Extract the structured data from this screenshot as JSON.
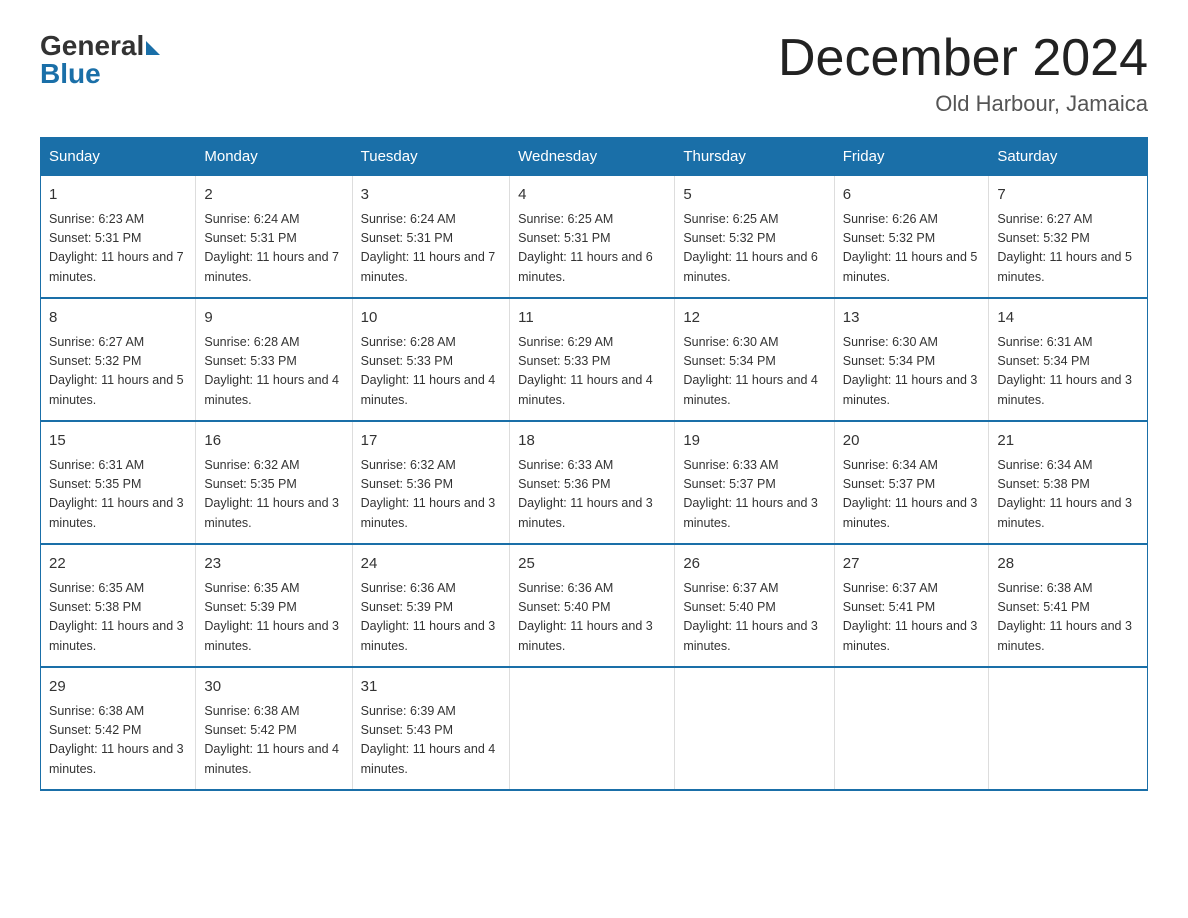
{
  "header": {
    "logo_general": "General",
    "logo_blue": "Blue",
    "title": "December 2024",
    "subtitle": "Old Harbour, Jamaica"
  },
  "days_of_week": [
    "Sunday",
    "Monday",
    "Tuesday",
    "Wednesday",
    "Thursday",
    "Friday",
    "Saturday"
  ],
  "weeks": [
    [
      {
        "day": "1",
        "sunrise": "6:23 AM",
        "sunset": "5:31 PM",
        "daylight": "11 hours and 7 minutes."
      },
      {
        "day": "2",
        "sunrise": "6:24 AM",
        "sunset": "5:31 PM",
        "daylight": "11 hours and 7 minutes."
      },
      {
        "day": "3",
        "sunrise": "6:24 AM",
        "sunset": "5:31 PM",
        "daylight": "11 hours and 7 minutes."
      },
      {
        "day": "4",
        "sunrise": "6:25 AM",
        "sunset": "5:31 PM",
        "daylight": "11 hours and 6 minutes."
      },
      {
        "day": "5",
        "sunrise": "6:25 AM",
        "sunset": "5:32 PM",
        "daylight": "11 hours and 6 minutes."
      },
      {
        "day": "6",
        "sunrise": "6:26 AM",
        "sunset": "5:32 PM",
        "daylight": "11 hours and 5 minutes."
      },
      {
        "day": "7",
        "sunrise": "6:27 AM",
        "sunset": "5:32 PM",
        "daylight": "11 hours and 5 minutes."
      }
    ],
    [
      {
        "day": "8",
        "sunrise": "6:27 AM",
        "sunset": "5:32 PM",
        "daylight": "11 hours and 5 minutes."
      },
      {
        "day": "9",
        "sunrise": "6:28 AM",
        "sunset": "5:33 PM",
        "daylight": "11 hours and 4 minutes."
      },
      {
        "day": "10",
        "sunrise": "6:28 AM",
        "sunset": "5:33 PM",
        "daylight": "11 hours and 4 minutes."
      },
      {
        "day": "11",
        "sunrise": "6:29 AM",
        "sunset": "5:33 PM",
        "daylight": "11 hours and 4 minutes."
      },
      {
        "day": "12",
        "sunrise": "6:30 AM",
        "sunset": "5:34 PM",
        "daylight": "11 hours and 4 minutes."
      },
      {
        "day": "13",
        "sunrise": "6:30 AM",
        "sunset": "5:34 PM",
        "daylight": "11 hours and 3 minutes."
      },
      {
        "day": "14",
        "sunrise": "6:31 AM",
        "sunset": "5:34 PM",
        "daylight": "11 hours and 3 minutes."
      }
    ],
    [
      {
        "day": "15",
        "sunrise": "6:31 AM",
        "sunset": "5:35 PM",
        "daylight": "11 hours and 3 minutes."
      },
      {
        "day": "16",
        "sunrise": "6:32 AM",
        "sunset": "5:35 PM",
        "daylight": "11 hours and 3 minutes."
      },
      {
        "day": "17",
        "sunrise": "6:32 AM",
        "sunset": "5:36 PM",
        "daylight": "11 hours and 3 minutes."
      },
      {
        "day": "18",
        "sunrise": "6:33 AM",
        "sunset": "5:36 PM",
        "daylight": "11 hours and 3 minutes."
      },
      {
        "day": "19",
        "sunrise": "6:33 AM",
        "sunset": "5:37 PM",
        "daylight": "11 hours and 3 minutes."
      },
      {
        "day": "20",
        "sunrise": "6:34 AM",
        "sunset": "5:37 PM",
        "daylight": "11 hours and 3 minutes."
      },
      {
        "day": "21",
        "sunrise": "6:34 AM",
        "sunset": "5:38 PM",
        "daylight": "11 hours and 3 minutes."
      }
    ],
    [
      {
        "day": "22",
        "sunrise": "6:35 AM",
        "sunset": "5:38 PM",
        "daylight": "11 hours and 3 minutes."
      },
      {
        "day": "23",
        "sunrise": "6:35 AM",
        "sunset": "5:39 PM",
        "daylight": "11 hours and 3 minutes."
      },
      {
        "day": "24",
        "sunrise": "6:36 AM",
        "sunset": "5:39 PM",
        "daylight": "11 hours and 3 minutes."
      },
      {
        "day": "25",
        "sunrise": "6:36 AM",
        "sunset": "5:40 PM",
        "daylight": "11 hours and 3 minutes."
      },
      {
        "day": "26",
        "sunrise": "6:37 AM",
        "sunset": "5:40 PM",
        "daylight": "11 hours and 3 minutes."
      },
      {
        "day": "27",
        "sunrise": "6:37 AM",
        "sunset": "5:41 PM",
        "daylight": "11 hours and 3 minutes."
      },
      {
        "day": "28",
        "sunrise": "6:38 AM",
        "sunset": "5:41 PM",
        "daylight": "11 hours and 3 minutes."
      }
    ],
    [
      {
        "day": "29",
        "sunrise": "6:38 AM",
        "sunset": "5:42 PM",
        "daylight": "11 hours and 3 minutes."
      },
      {
        "day": "30",
        "sunrise": "6:38 AM",
        "sunset": "5:42 PM",
        "daylight": "11 hours and 4 minutes."
      },
      {
        "day": "31",
        "sunrise": "6:39 AM",
        "sunset": "5:43 PM",
        "daylight": "11 hours and 4 minutes."
      },
      null,
      null,
      null,
      null
    ]
  ],
  "labels": {
    "sunrise_prefix": "Sunrise: ",
    "sunset_prefix": "Sunset: ",
    "daylight_prefix": "Daylight: "
  }
}
